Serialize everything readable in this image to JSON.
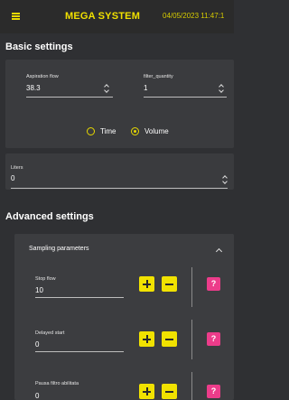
{
  "header": {
    "title": "MEGA SYSTEM",
    "datetime": "04/05/2023 11:47:1"
  },
  "basic_settings": {
    "title": "Basic settings",
    "aspiration_flow": {
      "label": "Aspiration flow",
      "value": "38.3"
    },
    "filter_quantity": {
      "label": "filter_quantity",
      "value": "1"
    },
    "mode_options": [
      {
        "label": "Time",
        "selected": false
      },
      {
        "label": "Volume",
        "selected": true
      }
    ],
    "liters": {
      "label": "Liters",
      "value": "0"
    }
  },
  "advanced_settings": {
    "title": "Advanced settings",
    "panel_title": "Sampling parameters",
    "rows": [
      {
        "label": "Stop flow",
        "value": "10",
        "help": "?"
      },
      {
        "label": "Delayed start",
        "value": "0",
        "help": "?"
      },
      {
        "label": "Pausa filtro abilitata",
        "value": "0",
        "help": "?"
      }
    ]
  },
  "colors": {
    "accent": "#f1e200",
    "help": "#ec3c8a",
    "background": "#2f3033",
    "card": "#3a3b3e"
  }
}
